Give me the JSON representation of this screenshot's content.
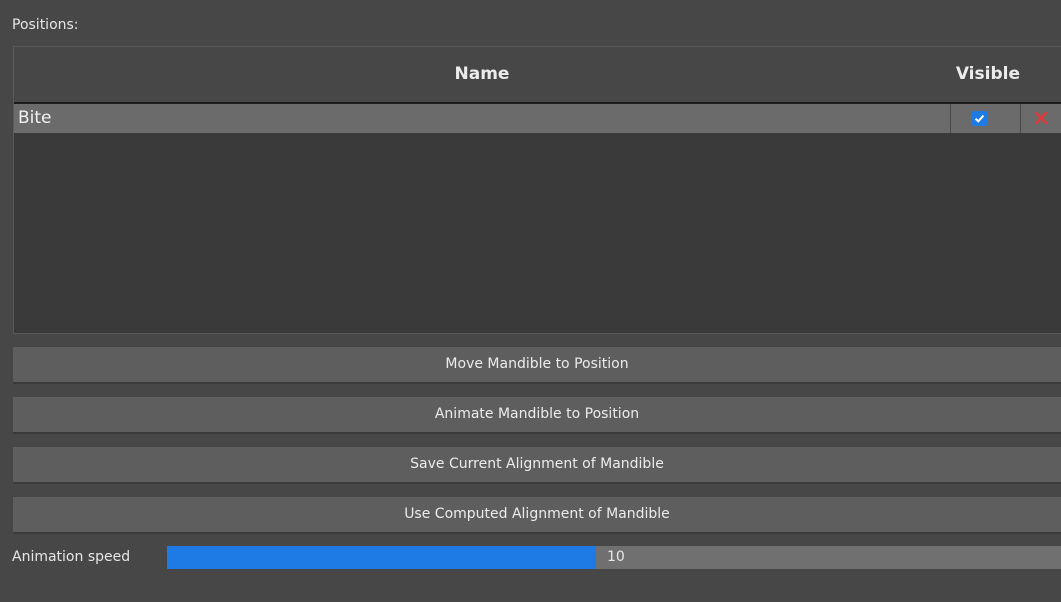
{
  "positions_label": "Positions:",
  "table": {
    "columns": [
      "Name",
      "Visible"
    ],
    "rows": [
      {
        "name": "Bite",
        "visible": true
      }
    ]
  },
  "buttons": {
    "move": "Move Mandible to Position",
    "animate": "Animate Mandible to Position",
    "save": "Save Current Alignment of Mandible",
    "use_computed": "Use Computed Alignment of Mandible"
  },
  "animation_speed": {
    "label": "Animation speed",
    "value": "10",
    "fill_fraction": 0.48
  },
  "colors": {
    "accent": "#1e7be6",
    "delete": "#e03a3a"
  }
}
